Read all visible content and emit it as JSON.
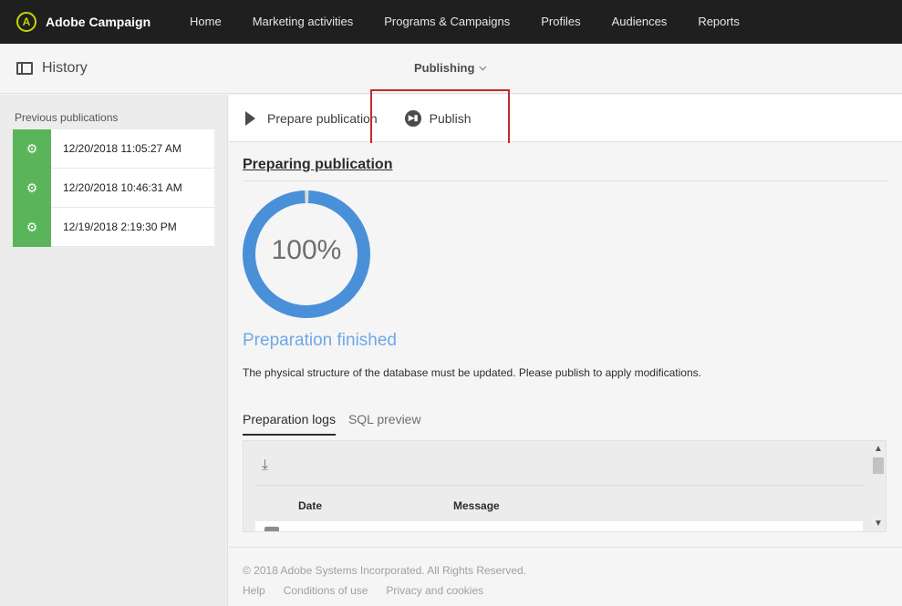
{
  "app": {
    "name": "Adobe Campaign",
    "logo_letter": "A"
  },
  "nav": {
    "items": [
      {
        "label": "Home"
      },
      {
        "label": "Marketing activities"
      },
      {
        "label": "Programs & Campaigns"
      },
      {
        "label": "Profiles"
      },
      {
        "label": "Audiences"
      },
      {
        "label": "Reports"
      }
    ]
  },
  "subheader": {
    "history_label": "History",
    "dropdown_label": "Publishing"
  },
  "sidebar": {
    "title": "Previous publications",
    "items": [
      {
        "date": "12/20/2018 11:05:27 AM",
        "icon": "gears-icon"
      },
      {
        "date": "12/20/2018 10:46:31 AM",
        "icon": "gears-icon"
      },
      {
        "date": "12/19/2018 2:19:30 PM",
        "icon": "gears-icon"
      }
    ]
  },
  "toolbar": {
    "prepare_label": "Prepare publication",
    "publish_label": "Publish"
  },
  "main": {
    "section_title": "Preparing publication",
    "progress": {
      "value": 100,
      "label": "100%"
    },
    "status": "Preparation finished",
    "info": "The physical structure of the database must be updated. Please publish to apply modifications.",
    "tabs": [
      {
        "label": "Preparation logs",
        "active": true
      },
      {
        "label": "SQL preview",
        "active": false
      }
    ],
    "logs": {
      "col_date": "Date",
      "col_message": "Message"
    }
  },
  "footer": {
    "copyright": "© 2018 Adobe Systems Incorporated. All Rights Reserved.",
    "links": [
      {
        "label": "Help"
      },
      {
        "label": "Conditions of use"
      },
      {
        "label": "Privacy and cookies"
      }
    ]
  },
  "colors": {
    "accent": "#4a90d9",
    "badge": "#5ab55a",
    "highlight": "#c22b2b",
    "brand": "#c4d600"
  }
}
